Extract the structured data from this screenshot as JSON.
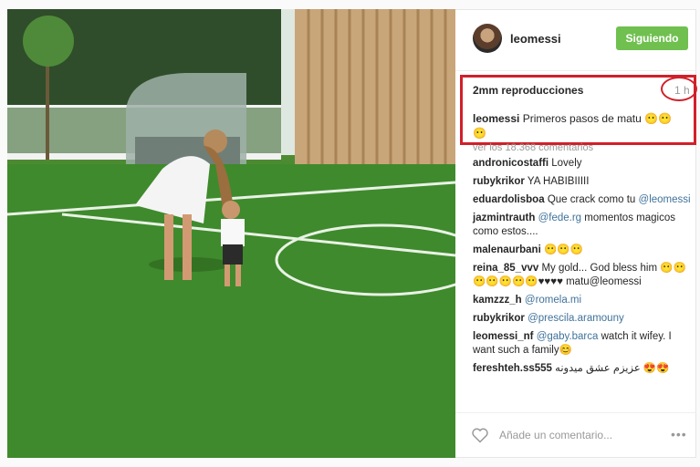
{
  "header": {
    "username": "leomessi",
    "follow_label": "Siguiendo"
  },
  "post": {
    "views": "2mm reproducciones",
    "time": "1 h",
    "caption_user": "leomessi",
    "caption_text": "Primeros pasos de matu 😶😶😶"
  },
  "comments": {
    "more_label": "ver los 18.368 comentarios",
    "items": [
      {
        "user": "andronicostaffi",
        "pre": "",
        "mention": "",
        "text": "Lovely"
      },
      {
        "user": "rubykrikor",
        "pre": "",
        "mention": "",
        "text": "YA HABIBIIIII"
      },
      {
        "user": "eduardolisboa",
        "pre": "Que crack como tu",
        "mention": "@leomessi",
        "text": ""
      },
      {
        "user": "jazmintrauth",
        "pre": "",
        "mention": "@fede.rg",
        "text": "momentos magicos como estos...."
      },
      {
        "user": "malenaurbani",
        "pre": "",
        "mention": "",
        "text": "😶😶😶"
      },
      {
        "user": "reina_85_vvv",
        "pre": "",
        "mention": "",
        "text": "My gold... God bless him 😶😶😶😶😶😶😶♥♥♥♥ matu@leomessi"
      },
      {
        "user": "kamzzz_h",
        "pre": "",
        "mention": "@romela.mi",
        "text": ""
      },
      {
        "user": "rubykrikor",
        "pre": "",
        "mention": "@prescila.aramouny",
        "text": ""
      },
      {
        "user": "leomessi_nf",
        "pre": "",
        "mention": "@gaby.barca",
        "text": "watch it wifey. I want such a family😊"
      },
      {
        "user": "fereshteh.ss555",
        "pre": "",
        "mention": "",
        "text": "عزيزم عشق ميدونه 😍😍"
      }
    ]
  },
  "footer": {
    "add_comment_placeholder": "Añade un comentario...",
    "more_dots": "•••"
  },
  "icons": {
    "heart": "heart-icon",
    "more": "more-options-icon"
  },
  "colors": {
    "follow_button": "#70c050",
    "highlight_border": "#d1202a",
    "link": "#3f729b"
  }
}
